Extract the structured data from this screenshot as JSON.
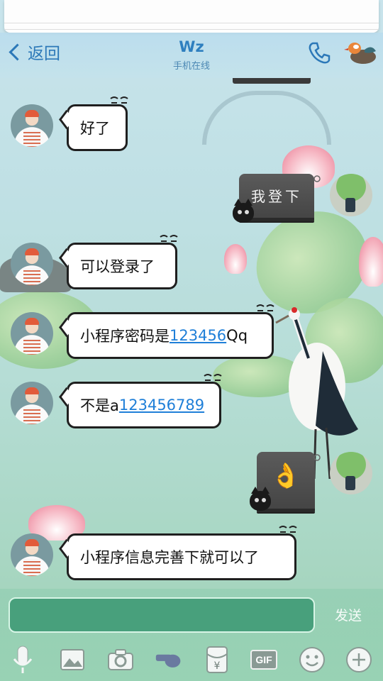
{
  "header": {
    "back_label": "返回",
    "title": "Wz",
    "subtitle": "手机在线"
  },
  "icons": {
    "back": "chevron-left-icon",
    "phone": "phone-icon",
    "profile": "mandarin-duck-icon",
    "voice": "microphone-icon",
    "image": "image-icon",
    "camera": "camera-icon",
    "whistle": "whistle-icon",
    "red_packet": "red-packet-icon",
    "gif": "gif-icon",
    "emoji": "emoji-icon",
    "plus": "plus-icon"
  },
  "messages": [
    {
      "side": "left",
      "type": "text",
      "text": "好了"
    },
    {
      "side": "right",
      "type": "sticker",
      "sticker_text": "我登下"
    },
    {
      "side": "left",
      "type": "text",
      "text": "可以登录了"
    },
    {
      "side": "left",
      "type": "text",
      "text_before": "小程序密码是",
      "link": "123456",
      "text_after": "Qq"
    },
    {
      "side": "left",
      "type": "text",
      "text_before": "不是a",
      "link": "123456789"
    },
    {
      "side": "right",
      "type": "sticker",
      "sticker_text": "👌"
    },
    {
      "side": "left",
      "type": "text",
      "text": "小程序信息完善下就可以了"
    }
  ],
  "composer": {
    "input_value": "",
    "send_label": "发送",
    "gif_label": "GIF",
    "red_packet_glyph": "¥"
  },
  "colors": {
    "accent": "#2c78b8",
    "link": "#1f7fd8",
    "input_bg": "#48a07c"
  }
}
